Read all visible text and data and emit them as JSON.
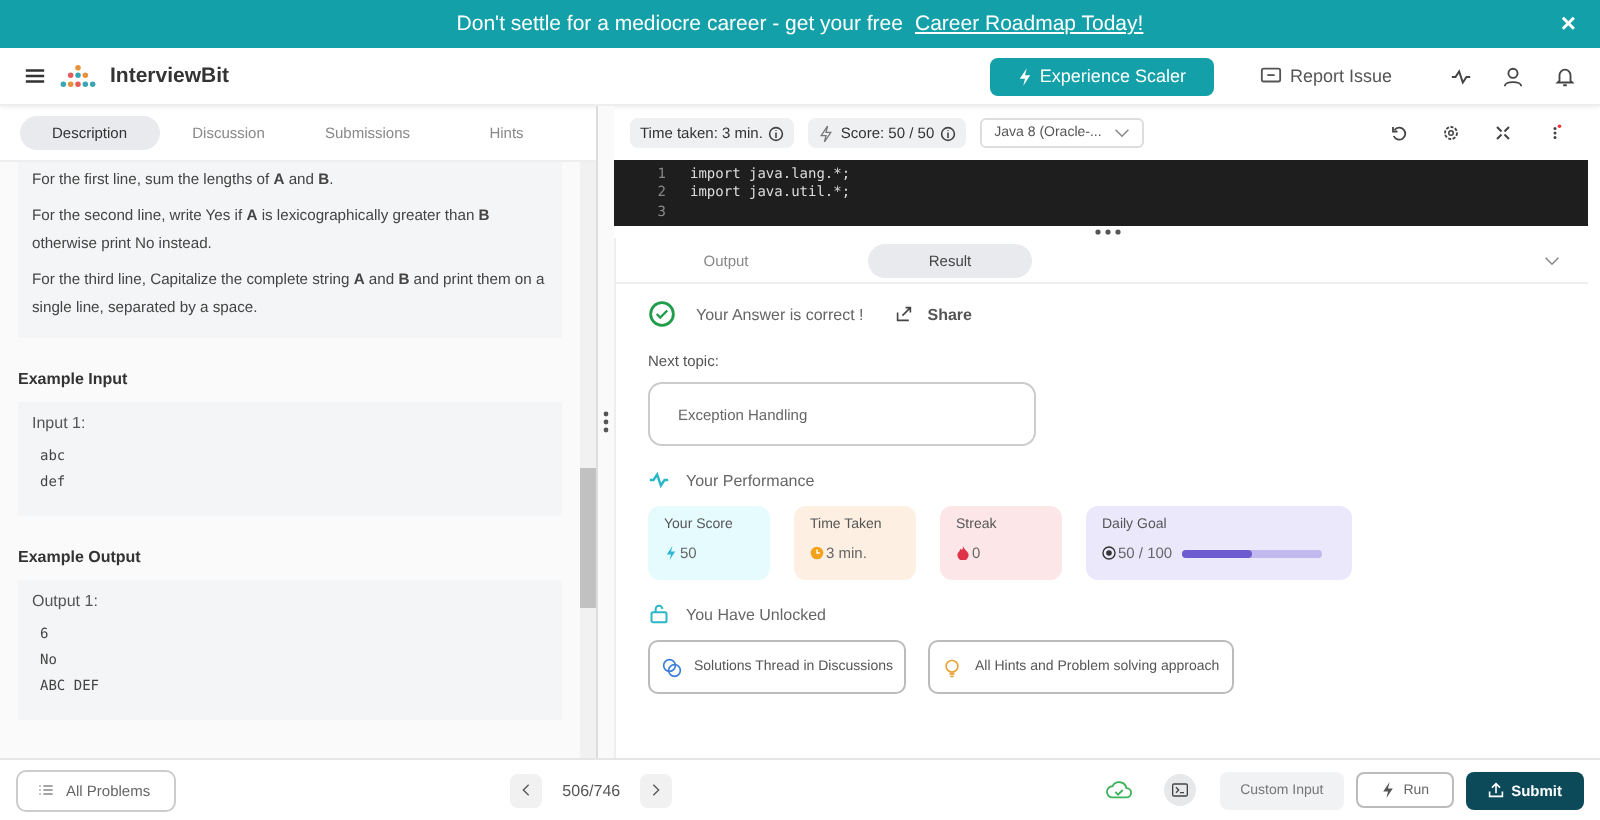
{
  "banner": {
    "text": "Don't settle for a mediocre career - get your free",
    "link": "Career Roadmap Today!",
    "close": "×"
  },
  "header": {
    "logo": "InterviewBit",
    "cta": "Experience Scaler",
    "report": "Report Issue"
  },
  "tabs": [
    {
      "label": "Description",
      "selected": true
    },
    {
      "label": "Discussion",
      "selected": false
    },
    {
      "label": "Submissions",
      "selected": false
    },
    {
      "label": "Hints",
      "selected": false
    }
  ],
  "description": [
    "For the first line, sum the lengths of **A** and **B**.",
    "For the second line, write Yes if **A** is lexicographically greater than **B** otherwise print No instead.",
    "For the third line, Capitalize the complete string **A** and **B** and print them on a single line, separated by a space."
  ],
  "examples": [
    {
      "heading": "Example Input",
      "label": "Input 1:",
      "lines": [
        "abc",
        "def"
      ]
    },
    {
      "heading": "Example Output",
      "label": "Output 1:",
      "lines": [
        "6",
        "No",
        "ABC DEF"
      ]
    }
  ],
  "toolbar": {
    "time_taken": "Time taken: 3 min.",
    "score": "Score: 50 / 50",
    "language": "Java 8 (Oracle-..."
  },
  "code": [
    {
      "number": "1",
      "text": "import java.lang.*;"
    },
    {
      "number": "2",
      "text": "import java.util.*;"
    },
    {
      "number": "3"
    }
  ],
  "result_tabs": [
    {
      "label": "Output",
      "selected": false
    },
    {
      "label": "Result",
      "selected": true
    }
  ],
  "result": {
    "message": "Your Answer is correct !",
    "share": "Share",
    "next_label": "Next topic:",
    "next_topic": "Exception Handling",
    "performance_title": "Your Performance",
    "stats": [
      {
        "kind": "score",
        "label": "Your Score",
        "value": "50",
        "color": "#e6fbfd"
      },
      {
        "kind": "time",
        "label": "Time Taken",
        "value": "3 min.",
        "color": "#fdf0e3"
      },
      {
        "kind": "streak",
        "label": "Streak",
        "value": "0",
        "color": "#fde6e8"
      },
      {
        "kind": "goal",
        "label": "Daily Goal",
        "value": "50 / 100",
        "color": "#ebe8fc",
        "level": 0.5
      }
    ],
    "unlocked_title": "You Have Unlocked",
    "unlocked": [
      {
        "kind": "discussion",
        "label": "Solutions Thread in Discussions"
      },
      {
        "kind": "hint",
        "label": "All Hints and Problem solving approach"
      }
    ]
  },
  "footer": {
    "all_problems": "All Problems",
    "pager": "506/746",
    "custom_input": "Custom Input",
    "run": "Run",
    "submit": "Submit"
  }
}
